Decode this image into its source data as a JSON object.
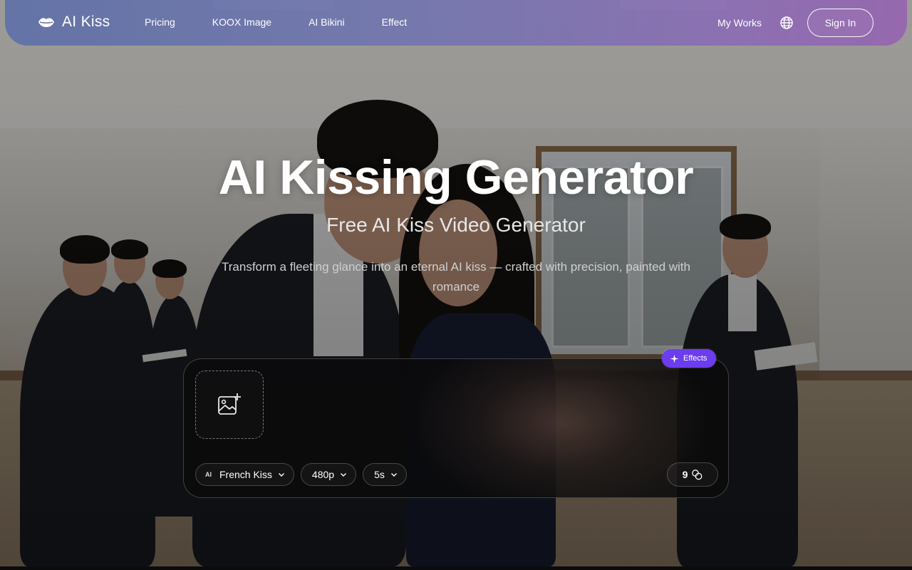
{
  "nav": {
    "logo_text": "AI Kiss",
    "links": [
      "Pricing",
      "KOOX Image",
      "AI Bikini",
      "Effect"
    ],
    "my_works": "My Works",
    "sign_in": "Sign In",
    "gradient_colors": [
      "#5c6ea8",
      "#9664b0"
    ]
  },
  "hero": {
    "title": "AI Kissing Generator",
    "subtitle": "Free AI Kiss Video Generator",
    "description": "Transform a fleeting glance into an eternal AI kiss — crafted with precision, painted with romance"
  },
  "generator": {
    "effects_label": "Effects",
    "effects_color": "#6b3cf0",
    "model_tag": "AI",
    "model": "French Kiss",
    "resolution": "480p",
    "duration": "5s",
    "credits": "9",
    "icons": {
      "upload": "image-add-icon",
      "effects": "sparkle-icon",
      "dropdown": "chevron-down-icon",
      "credits": "coins-icon"
    }
  }
}
